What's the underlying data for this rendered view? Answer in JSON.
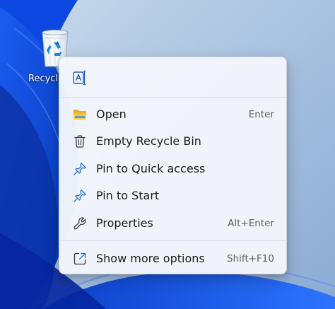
{
  "desktop": {
    "recycle_bin_label": "Recycle"
  },
  "context_menu": {
    "quick_actions": [
      {
        "icon": "rename-icon",
        "tooltip": ""
      }
    ],
    "items": [
      {
        "label": "Open",
        "accelerator": "Enter",
        "icon": "folder-icon"
      },
      {
        "label": "Empty Recycle Bin",
        "accelerator": "",
        "icon": "trash-icon"
      },
      {
        "label": "Pin to Quick access",
        "accelerator": "",
        "icon": "pin-icon"
      },
      {
        "label": "Pin to Start",
        "accelerator": "",
        "icon": "pin-icon"
      },
      {
        "label": "Properties",
        "accelerator": "Alt+Enter",
        "icon": "wrench-icon"
      }
    ],
    "more_options": {
      "label": "Show more options",
      "accelerator": "Shift+F10",
      "icon": "open-external-icon"
    }
  },
  "colors": {
    "accent": "#0f6cbd",
    "menu_background": "#f3f6fb",
    "wallpaper_blue": "#0a4fd6"
  }
}
